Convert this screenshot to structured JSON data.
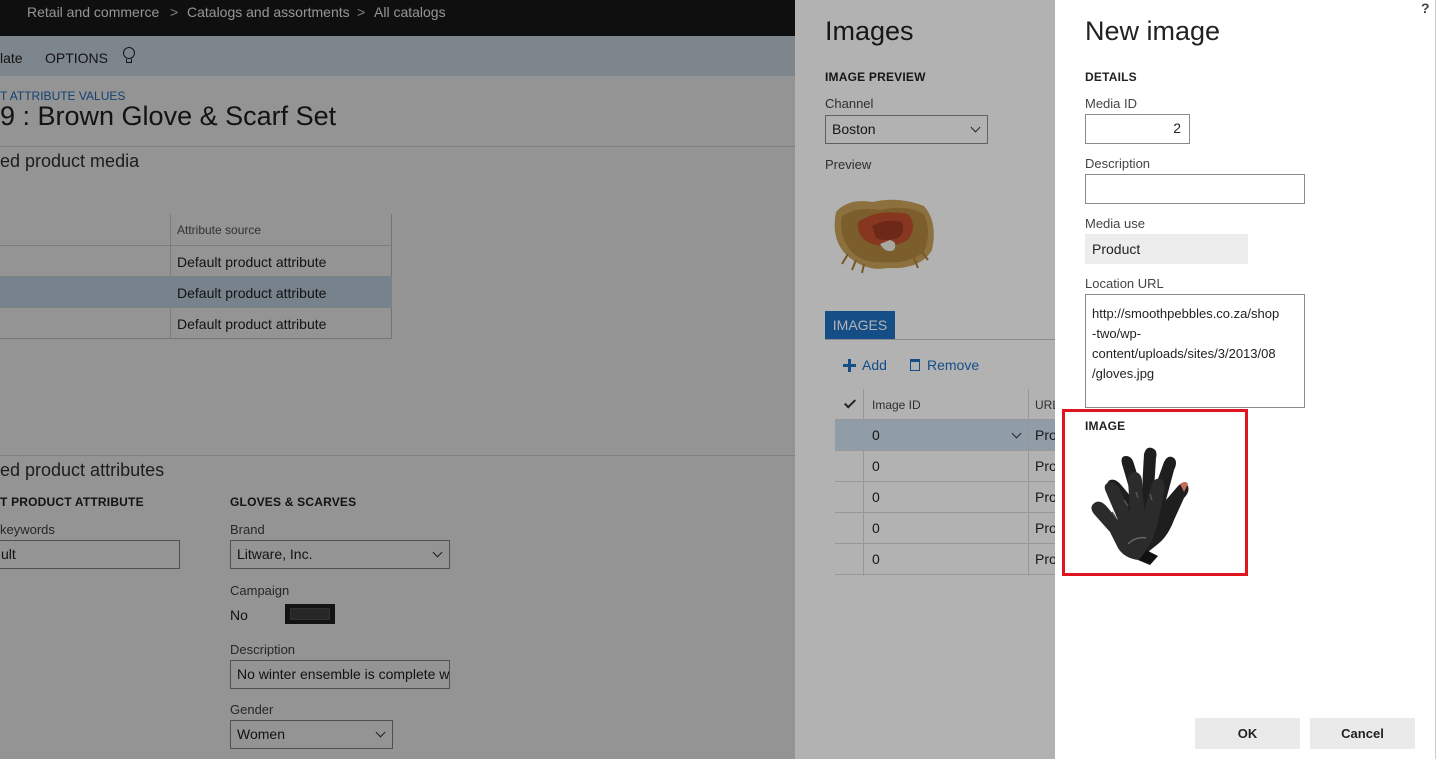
{
  "breadcrumb": {
    "items": [
      "Retail and commerce",
      "Catalogs and assortments",
      "All catalogs"
    ],
    "separator": ">"
  },
  "actionbar": {
    "items": [
      "late",
      "OPTIONS"
    ],
    "icon": "lightbulb-icon"
  },
  "product": {
    "link": "T ATTRIBUTE VALUES",
    "title": "9 : Brown Glove & Scarf Set"
  },
  "media_section": {
    "heading": "ed product media",
    "column_header": "Attribute source",
    "rows": [
      "Default product attribute",
      "Default product attribute",
      "Default product attribute"
    ]
  },
  "attributes_section": {
    "heading": "ed product attributes",
    "group_left": "T PRODUCT ATTRIBUTE",
    "keywords_label": "keywords",
    "keywords_value": "ult",
    "group_right": "GLOVES & SCARVES",
    "brand_label": "Brand",
    "brand_value": "Litware, Inc.",
    "campaign_label": "Campaign",
    "campaign_value": "No",
    "description_label": "Description",
    "description_value": "No winter ensemble is complete w",
    "gender_label": "Gender",
    "gender_value": "Women"
  },
  "images_panel": {
    "title": "Images",
    "preview_head": "IMAGE PREVIEW",
    "channel_label": "Channel",
    "channel_value": "Boston",
    "preview_label": "Preview",
    "tab": "IMAGES",
    "add": "Add",
    "remove": "Remove",
    "col_image_id": "Image ID",
    "col_url": "URL",
    "rows": [
      {
        "id": "0",
        "url": "Pro"
      },
      {
        "id": "0",
        "url": "Pro"
      },
      {
        "id": "0",
        "url": "Pro"
      },
      {
        "id": "0",
        "url": "Pro"
      },
      {
        "id": "0",
        "url": "Pro"
      }
    ]
  },
  "new_image": {
    "title": "New image",
    "details_head": "DETAILS",
    "media_id_label": "Media ID",
    "media_id_value": "2",
    "description_label": "Description",
    "description_value": "",
    "media_use_label": "Media use",
    "media_use_value": "Product",
    "location_label": "Location URL",
    "location_lines": [
      "http://smoothpebbles.co.za/shop",
      "-two/wp-",
      "content/uploads/sites/3/2013/08",
      "/gloves.jpg"
    ],
    "image_head": "IMAGE",
    "ok": "OK",
    "cancel": "Cancel",
    "help": "?"
  },
  "colors": {
    "accent": "#1f6fc2",
    "highlight": "#e0141e",
    "topbar": "#1a1a1a"
  }
}
